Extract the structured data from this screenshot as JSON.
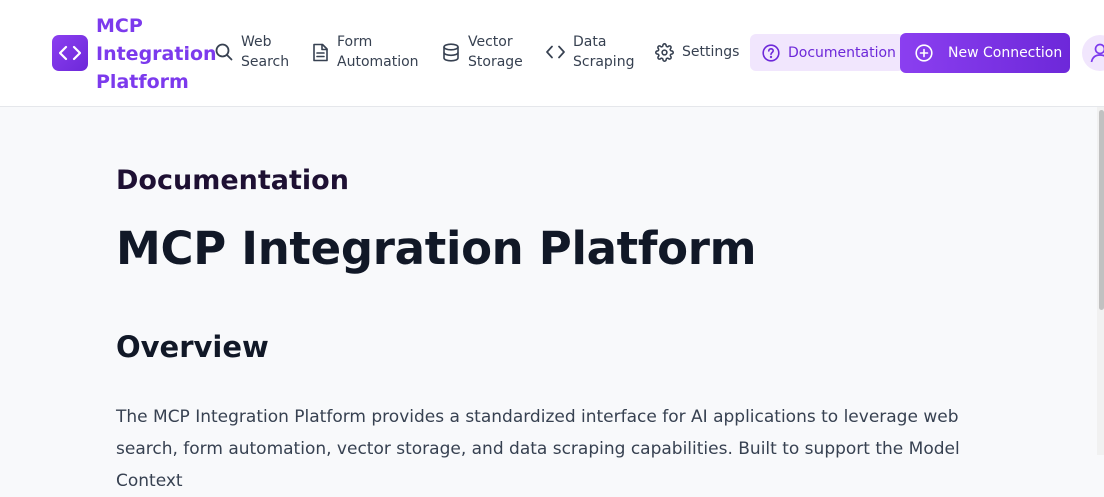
{
  "brand": {
    "line1": "MCP",
    "line2": "Integration",
    "line3": "Platform"
  },
  "nav": [
    {
      "line1": "Web",
      "line2": "Search",
      "icon": "search-icon"
    },
    {
      "line1": "Form",
      "line2": "Automation",
      "icon": "document-icon"
    },
    {
      "line1": "Vector",
      "line2": "Storage",
      "icon": "database-icon"
    },
    {
      "line1": "Data",
      "line2": "Scraping",
      "icon": "code-icon"
    },
    {
      "line1": "Settings",
      "icon": "gear-icon"
    }
  ],
  "header_buttons": {
    "documentation": "Documentation",
    "new_connection": "New Connection"
  },
  "content": {
    "section_label": "Documentation",
    "title": "MCP Integration Platform",
    "overview_heading": "Overview",
    "paragraph": "The MCP Integration Platform provides a standardized interface for AI applications to leverage web search, form automation, vector storage, and data scraping capabilities. Built to support the Model Context"
  },
  "colors": {
    "brand": "#7c3aed",
    "accent_light": "#f1e6fd",
    "background": "#f8f9fb"
  }
}
